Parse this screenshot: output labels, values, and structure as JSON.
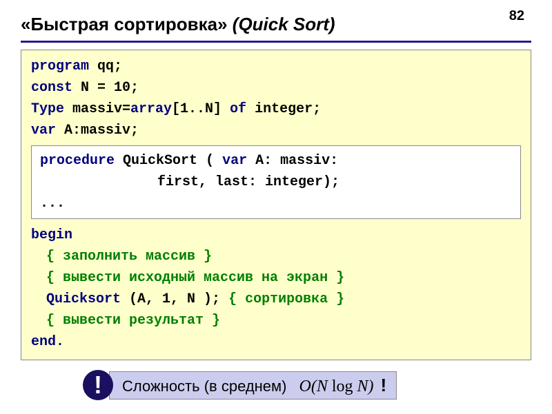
{
  "page_number": "82",
  "title_ru": "«Быстрая сортировка»",
  "title_en": "(Quick Sort)",
  "code": {
    "l1a": "program",
    "l1b": " qq;",
    "l2a": "const",
    "l2b": " N = 10;",
    "l3a": "Type",
    "l3b": " massiv=",
    "l3c": "array",
    "l3d": "[1..N] ",
    "l3e": "of",
    "l3f": " integer;",
    "l4a": "var",
    "l4b": " A:massiv;",
    "p1a": "procedure",
    "p1b": " QuickSort ( ",
    "p1c": "var",
    "p1d": " A: massiv:",
    "p2": "first, last: integer);",
    "p3": "...",
    "b1": "begin",
    "c1": "{ заполнить массив }",
    "c2": "{ вывести исходный массив на экран }",
    "q1": "Quicksort ",
    "q2": "(A, 1, N );",
    "c3": " { сортировка }",
    "c4": "{ вывести результат }",
    "b2": "end."
  },
  "footer": {
    "bang": "!",
    "label": "Сложность (в среднем)",
    "bigO_open": "O(",
    "bigO_N1": "N ",
    "bigO_log": "log ",
    "bigO_N2": "N",
    "bigO_close": ")",
    "excl": "!"
  }
}
